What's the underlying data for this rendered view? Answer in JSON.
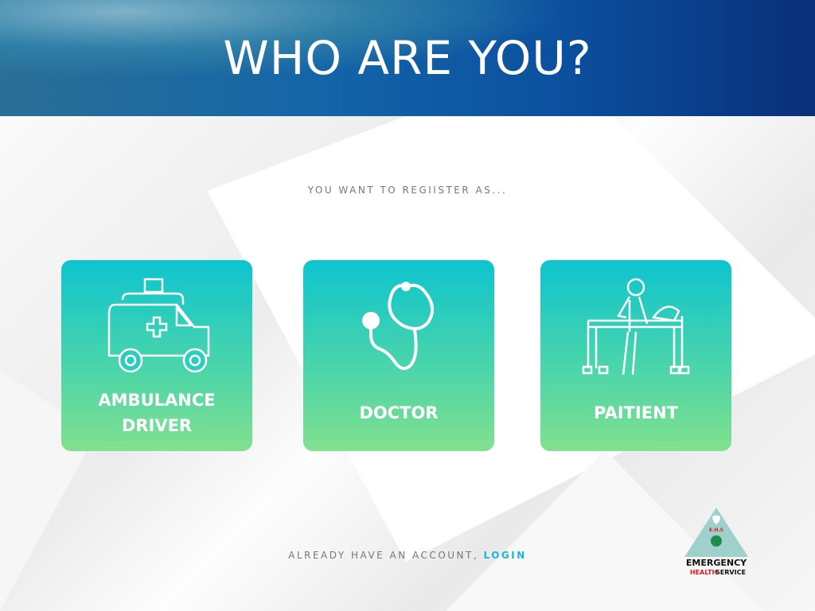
{
  "header": {
    "title": "WHO ARE YOU?"
  },
  "subtitle": "YOU WANT TO REGIISTER AS...",
  "roles": [
    {
      "label_line1": "AMBULANCE",
      "label_line2": "DRIVER",
      "icon": "ambulance-icon"
    },
    {
      "label": "DOCTOR",
      "icon": "stethoscope-icon"
    },
    {
      "label": "PAITIENT",
      "icon": "patient-bed-icon"
    }
  ],
  "footer": {
    "text": "ALREADY HAVE AN ACCOUNT, ",
    "link": "LOGIN"
  },
  "logo": {
    "line1": "EMERGENCY",
    "line2a": "HEALTH",
    "line2b": "SERVICE",
    "badge": "E.H.S"
  },
  "colors": {
    "card_top": "#0dc4cf",
    "card_bottom": "#82e08e",
    "link": "#19b6d6"
  }
}
